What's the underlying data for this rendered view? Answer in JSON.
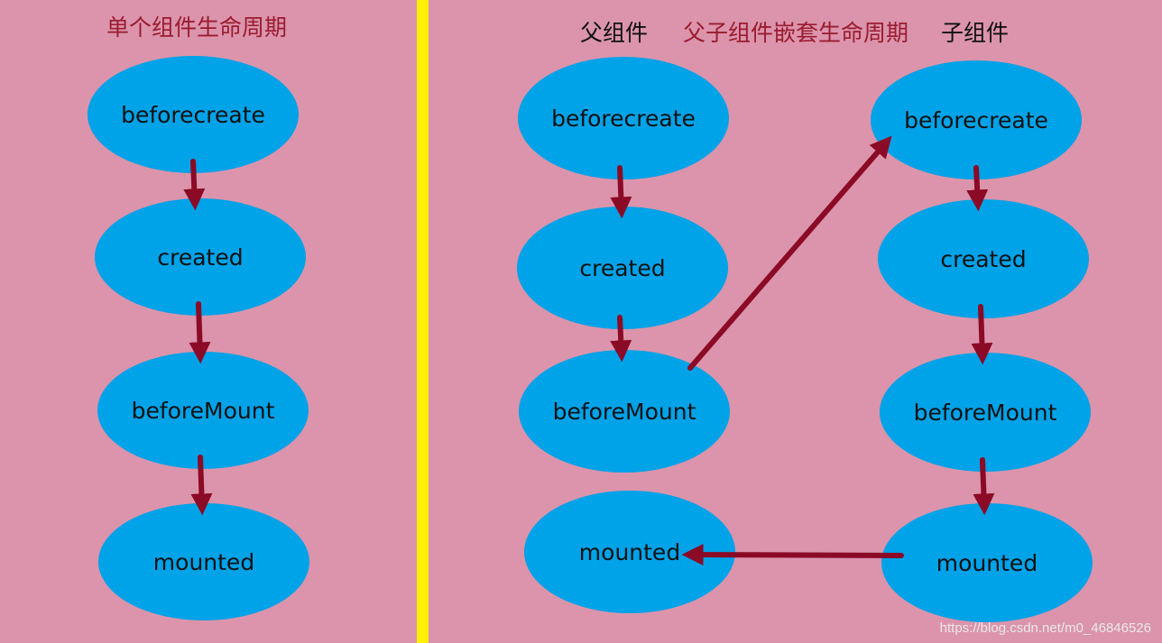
{
  "titles": {
    "single": "单个组件生命周期",
    "parent": "父组件",
    "nested": "父子组件嵌套生命周期",
    "child": "子组件"
  },
  "colors": {
    "background": "#db94ab",
    "divider": "#ffef00",
    "node_fill": "#00a2e8",
    "arrow": "#8b0a25",
    "title_red": "#9b1b30"
  },
  "diagram": {
    "single": [
      {
        "id": "s-beforecreate",
        "label": "beforecreate"
      },
      {
        "id": "s-created",
        "label": "created"
      },
      {
        "id": "s-beforemount",
        "label": "beforeMount"
      },
      {
        "id": "s-mounted",
        "label": "mounted"
      }
    ],
    "parent": [
      {
        "id": "p-beforecreate",
        "label": "beforecreate"
      },
      {
        "id": "p-created",
        "label": "created"
      },
      {
        "id": "p-beforemount",
        "label": "beforeMount"
      },
      {
        "id": "p-mounted",
        "label": "mounted"
      }
    ],
    "child": [
      {
        "id": "c-beforecreate",
        "label": "beforecreate"
      },
      {
        "id": "c-created",
        "label": "created"
      },
      {
        "id": "c-beforemount",
        "label": "beforeMount"
      },
      {
        "id": "c-mounted",
        "label": "mounted"
      }
    ],
    "edges": [
      {
        "from": "s-beforecreate",
        "to": "s-created"
      },
      {
        "from": "s-created",
        "to": "s-beforemount"
      },
      {
        "from": "s-beforemount",
        "to": "s-mounted"
      },
      {
        "from": "p-beforecreate",
        "to": "p-created"
      },
      {
        "from": "p-created",
        "to": "p-beforemount"
      },
      {
        "from": "p-beforemount",
        "to": "c-beforecreate"
      },
      {
        "from": "c-beforecreate",
        "to": "c-created"
      },
      {
        "from": "c-created",
        "to": "c-beforemount"
      },
      {
        "from": "c-beforemount",
        "to": "c-mounted"
      },
      {
        "from": "c-mounted",
        "to": "p-mounted"
      }
    ]
  },
  "watermark": "https://blog.csdn.net/m0_46846526"
}
